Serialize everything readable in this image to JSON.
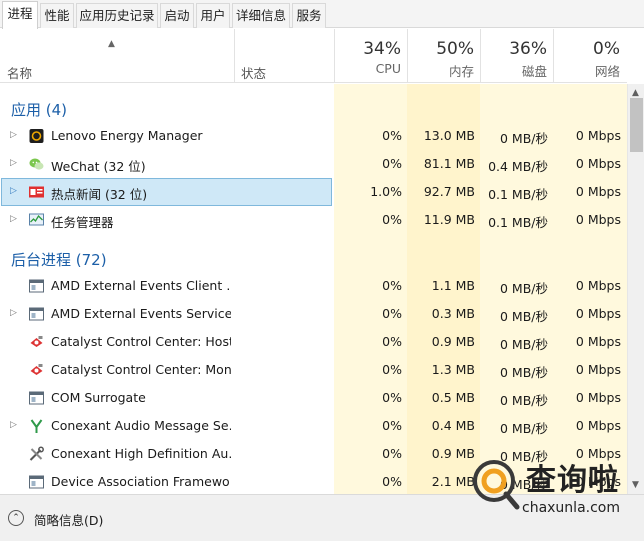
{
  "tabs": [
    "进程",
    "性能",
    "应用历史记录",
    "启动",
    "用户",
    "详细信息",
    "服务"
  ],
  "header": {
    "name_label": "名称",
    "status_label": "状态",
    "cpu": {
      "pct": "34%",
      "label": "CPU"
    },
    "memory": {
      "pct": "50%",
      "label": "内存"
    },
    "disk": {
      "pct": "36%",
      "label": "磁盘"
    },
    "network": {
      "pct": "0%",
      "label": "网络"
    }
  },
  "groups": {
    "apps_title": "应用 (4)",
    "background_title": "后台进程 (72)"
  },
  "apps": [
    {
      "name": "Lenovo Energy Manager",
      "cpu": "0%",
      "mem": "13.0 MB",
      "disk": "0 MB/秒",
      "net": "0 Mbps",
      "icon": "lenovo-energy-icon"
    },
    {
      "name": "WeChat (32 位)",
      "cpu": "0%",
      "mem": "81.1 MB",
      "disk": "0.4 MB/秒",
      "net": "0 Mbps",
      "icon": "wechat-icon"
    },
    {
      "name": "热点新闻 (32 位)",
      "cpu": "1.0%",
      "mem": "92.7 MB",
      "disk": "0.1 MB/秒",
      "net": "0 Mbps",
      "icon": "hot-news-icon"
    },
    {
      "name": "任务管理器",
      "cpu": "0%",
      "mem": "11.9 MB",
      "disk": "0.1 MB/秒",
      "net": "0 Mbps",
      "icon": "task-manager-icon"
    }
  ],
  "background": [
    {
      "name": "AMD External Events Client …",
      "cpu": "0%",
      "mem": "1.1 MB",
      "disk": "0 MB/秒",
      "net": "0 Mbps",
      "icon": "service-window-icon"
    },
    {
      "name": "AMD External Events Service …",
      "cpu": "0%",
      "mem": "0.3 MB",
      "disk": "0 MB/秒",
      "net": "0 Mbps",
      "icon": "service-window-icon"
    },
    {
      "name": "Catalyst Control Center: Host…",
      "cpu": "0%",
      "mem": "0.9 MB",
      "disk": "0 MB/秒",
      "net": "0 Mbps",
      "icon": "catalyst-icon"
    },
    {
      "name": "Catalyst Control Center: Mon…",
      "cpu": "0%",
      "mem": "1.3 MB",
      "disk": "0 MB/秒",
      "net": "0 Mbps",
      "icon": "catalyst-icon"
    },
    {
      "name": "COM Surrogate",
      "cpu": "0%",
      "mem": "0.5 MB",
      "disk": "0 MB/秒",
      "net": "0 Mbps",
      "icon": "service-window-icon"
    },
    {
      "name": "Conexant Audio Message Se…",
      "cpu": "0%",
      "mem": "0.4 MB",
      "disk": "0 MB/秒",
      "net": "0 Mbps",
      "icon": "conexant-audio-icon"
    },
    {
      "name": "Conexant High Definition Au…",
      "cpu": "0%",
      "mem": "0.9 MB",
      "disk": "0 MB/秒",
      "net": "0 Mbps",
      "icon": "tools-icon"
    },
    {
      "name": "Device Association Framewo…",
      "cpu": "0%",
      "mem": "2.1 MB",
      "disk": "0 MB/秒",
      "net": "0 Mbps",
      "icon": "service-window-icon"
    }
  ],
  "footer": {
    "fewer_details": "简略信息(D)"
  },
  "watermark": {
    "brand": "查询啦",
    "domain": "chaxunla.com"
  },
  "colors": {
    "accent": "#1c5fa8",
    "selected_row": "#cfe8f7",
    "heat_light": "#fff8dc",
    "heat_mid": "#fff2c4"
  }
}
